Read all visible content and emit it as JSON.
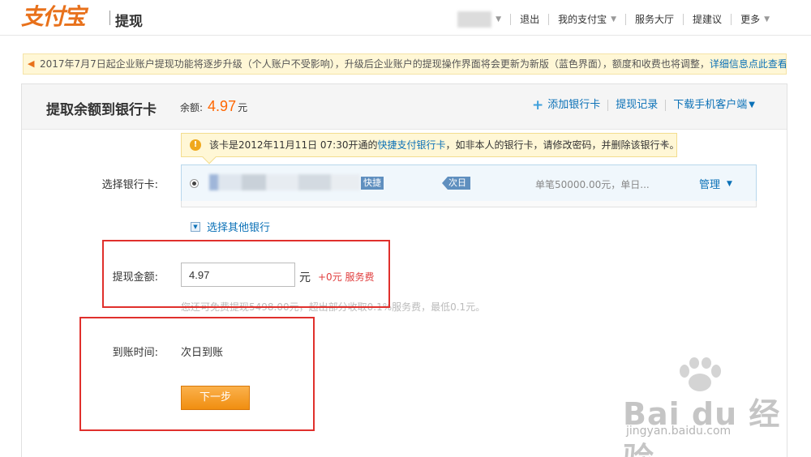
{
  "header": {
    "logo_text": "支付宝",
    "page_name": "提现",
    "nav": [
      "退出",
      "我的支付宝",
      "服务大厅",
      "提建议",
      "更多"
    ]
  },
  "notice": {
    "text": "2017年7月7日起企业账户提现功能将逐步升级（个人账户不受影响），升级后企业账户的提现操作界面将会更新为新版（蓝色界面），额度和收费也将调整，",
    "link": "详细信息点此查看",
    "tail": "。"
  },
  "panel": {
    "title": "提取余额到银行卡",
    "balance_label": "余额:",
    "balance_amount": "4.97",
    "balance_unit": "元",
    "links": {
      "add_card": "添加银行卡",
      "records": "提现记录",
      "download": "下载手机客户端"
    }
  },
  "warning": {
    "text_before": "该卡是2012年11月11日 07:30开通的",
    "link": "快捷支付银行卡",
    "text_after": "，如非本人的银行卡，请修改密码，并删除该银行卡。",
    "close": "×"
  },
  "card_select": {
    "label": "选择银行卡:",
    "tag_quick": "快捷",
    "tag_next": "次日",
    "limit": "单笔50000.00元，单日...",
    "manage": "管理",
    "other_bank": "选择其他银行"
  },
  "amount": {
    "label": "提现金额:",
    "value": "4.97",
    "unit": "元",
    "fee": "+0元 服务费",
    "hint": "您还可免费提现5498.00元，超出部分收取0.1%服务费，最低0.1元。"
  },
  "arrival": {
    "label": "到账时间:",
    "value": "次日到账"
  },
  "next_button": "下一步",
  "watermark": {
    "text": "Bai du 经验",
    "url": "jingyan.baidu.com"
  },
  "colors": {
    "accent_orange": "#f08e10",
    "link_blue": "#0b71b7",
    "balance_red": "#ff6600",
    "highlight_red": "#e0302c"
  }
}
